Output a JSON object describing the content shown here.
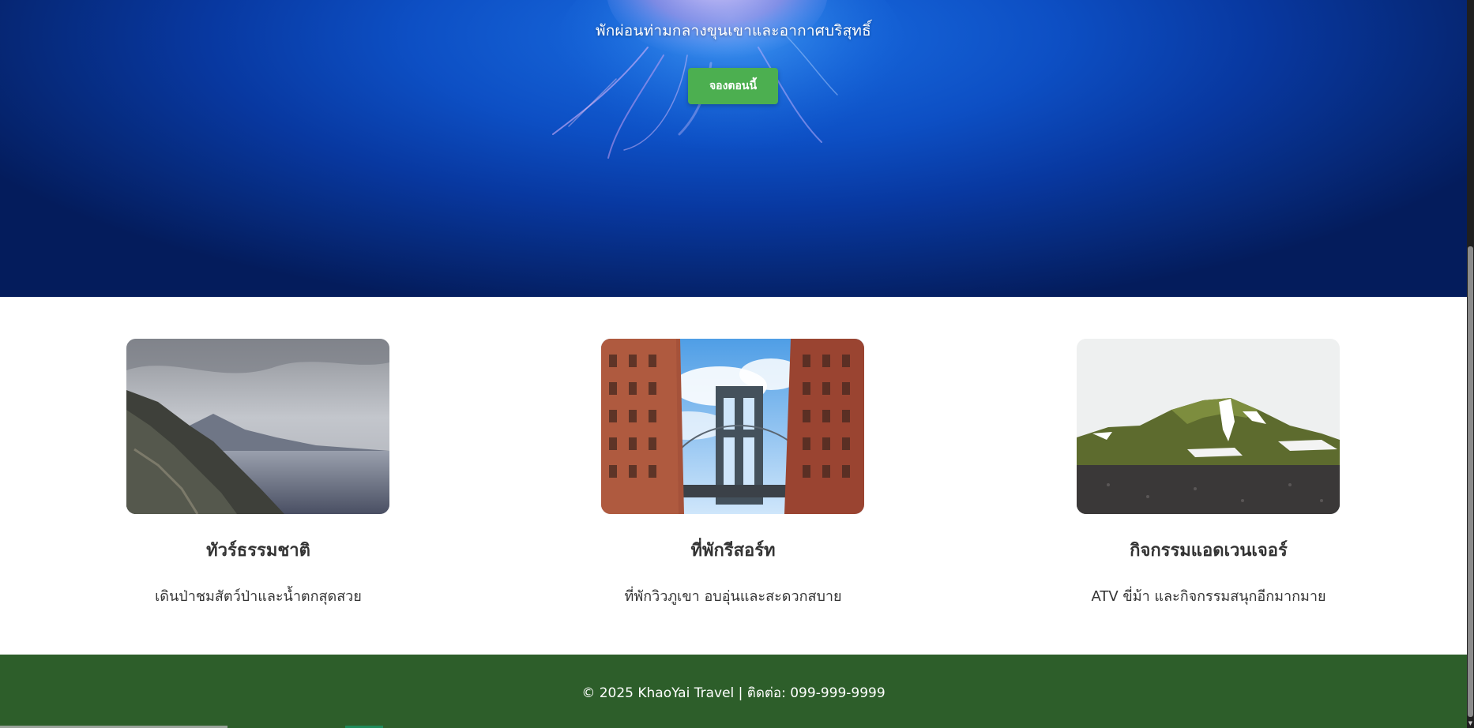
{
  "hero": {
    "subtitle": "พักผ่อนท่ามกลางขุนเขาและอากาศบริสุทธิ์",
    "book_button": "จองตอนนี้",
    "colors": {
      "ocean": "#0d4fc4",
      "button": "#4caf50"
    }
  },
  "features": [
    {
      "title": "ทัวร์ธรรมชาติ",
      "description": "เดินป่าชมสัตว์ป่าและน้ำตกสุดสวย"
    },
    {
      "title": "ที่พักรีสอร์ท",
      "description": "ที่พักวิวภูเขา อบอุ่นและสะดวกสบาย"
    },
    {
      "title": "กิจกรรมแอดเวนเจอร์",
      "description": "ATV ขี่ม้า และกิจกรรมสนุกอีกมากมาย"
    }
  ],
  "footer": {
    "text": "© 2025 KhaoYai Travel | ติดต่อ: 099-999-9999",
    "color": "#2d5e2a"
  }
}
